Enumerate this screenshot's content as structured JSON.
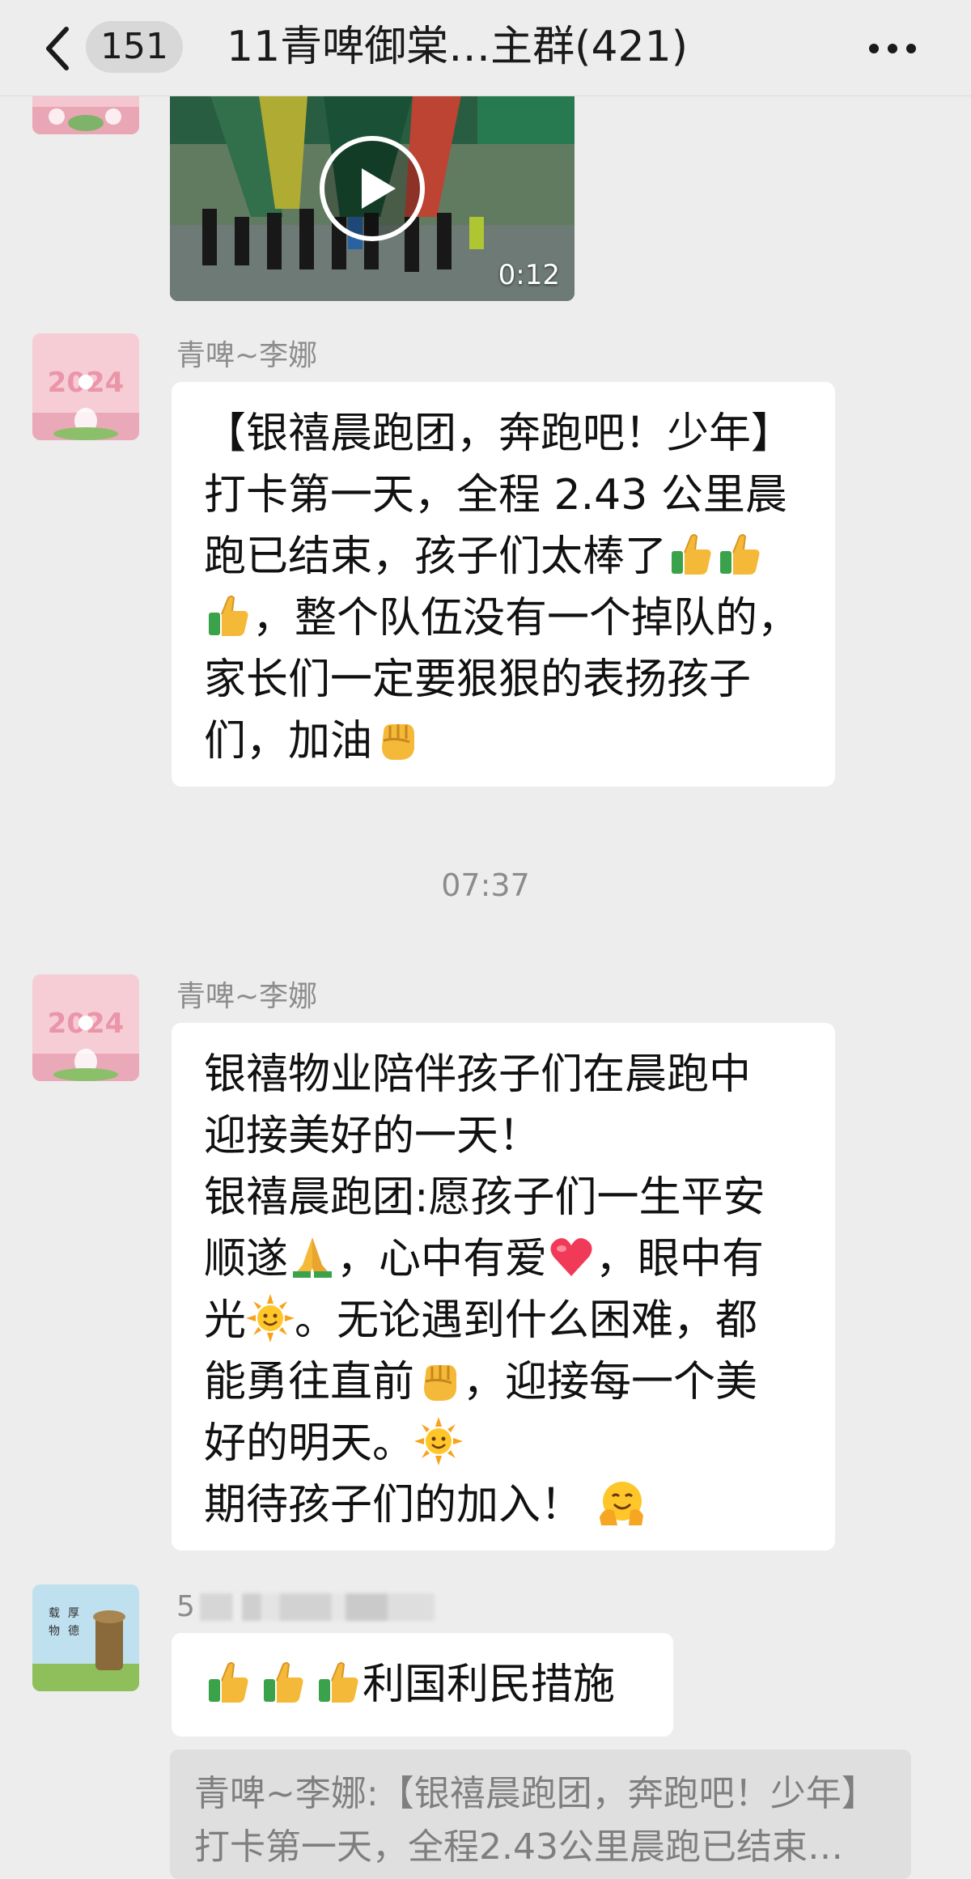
{
  "header": {
    "unread_count": "151",
    "title": "11青啤御棠…主群(421)"
  },
  "video": {
    "duration": "0:12"
  },
  "messages": [
    {
      "sender": "青啤~李娜",
      "lines": [
        "【银禧晨跑团，奔跑吧！少年】",
        "打卡第一天，全程 2.43 公里晨",
        "跑已结束，孩子们太棒了",
        "，整个队伍没有一个掉队的，",
        "家长们一定要狠狠的表扬孩子",
        "们，加油"
      ]
    },
    {
      "sender": "青啤~李娜",
      "lines": [
        "银禧物业陪伴孩子们在晨跑中",
        "迎接美好的一天！",
        "银禧晨跑团:愿孩子们一生平安",
        "顺遂",
        "，心中有爱",
        "，眼中有",
        "光",
        "。无论遇到什么困难，都",
        "能勇往直前",
        "，迎接每一个美",
        "好的明天。",
        "期待孩子们的加入！"
      ]
    },
    {
      "sender": "5",
      "text": "利国利民措施",
      "quote_lines": [
        "青啤~李娜:【银禧晨跑团，奔跑吧！少年】",
        "打卡第一天，全程2.43公里晨跑已结束…"
      ]
    }
  ],
  "timestamp": "07:37",
  "avatar": {
    "year_text": "2024",
    "calligraphy": [
      "载",
      "厚",
      "物",
      "德"
    ]
  },
  "icons": {
    "back": "back-arrow-icon",
    "more": "more-dots-icon",
    "play": "play-icon",
    "thumbs_up": "thumbs-up-emoji",
    "fist": "fist-emoji",
    "pray": "pray-emoji",
    "heart": "heart-emoji",
    "sun": "sun-emoji",
    "hug": "hugging-emoji"
  }
}
